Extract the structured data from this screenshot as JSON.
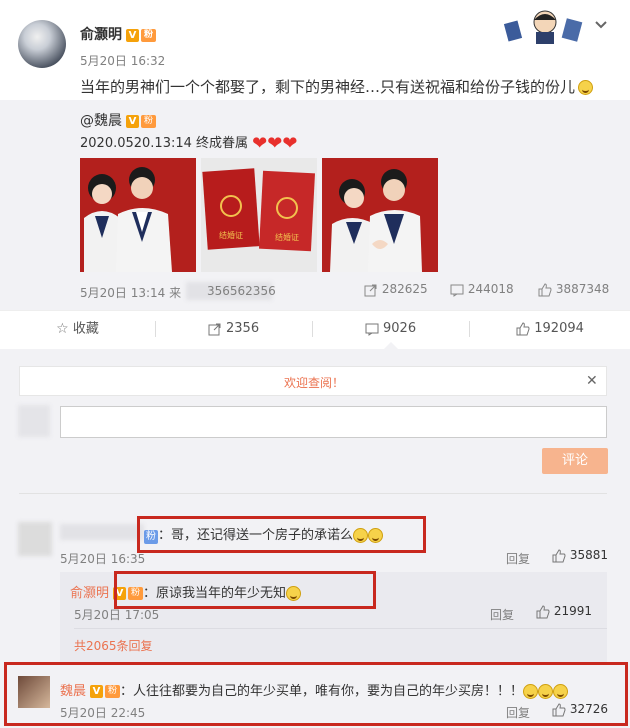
{
  "post": {
    "author": "俞灏明",
    "time": "5月20日 16:32",
    "text": "当年的男神们一个个都娶了，剩下的男神经…只有送祝福和给份子钱的份儿",
    "verified_icon": "v-badge-icon",
    "fan_icon": "fan-badge-icon"
  },
  "repost": {
    "author": "@魏晨",
    "text": "2020.0520.13:14 终成眷属",
    "time": "5月20日 13:14 来",
    "source": "356562356",
    "forwards": "282625",
    "comments": "244018",
    "likes": "3887348",
    "certificate_label": "结婚证"
  },
  "actions": {
    "favorite": "收藏",
    "forward": "2356",
    "comment": "9026",
    "like": "192094"
  },
  "comment_box": {
    "welcome": "欢迎查阅！",
    "submit": "评论",
    "placeholder": ""
  },
  "comments": [
    {
      "tag": "粉",
      "text": "：哥，还记得送一个房子的承诺么",
      "time": "5月20日 16:35",
      "reply": "回复",
      "likes": "35881"
    },
    {
      "author": "俞灏明",
      "text": "：原谅我当年的年少无知",
      "time": "5月20日 17:05",
      "reply": "回复",
      "likes": "21991"
    }
  ],
  "more_replies": "共2065条回复",
  "last_comment": {
    "author": "魏晨",
    "text": "：人往往都要为自己的年少买单，唯有你，要为自己的年少买房！！！",
    "time": "5月20日 22:45",
    "reply": "回复",
    "likes": "32726"
  }
}
